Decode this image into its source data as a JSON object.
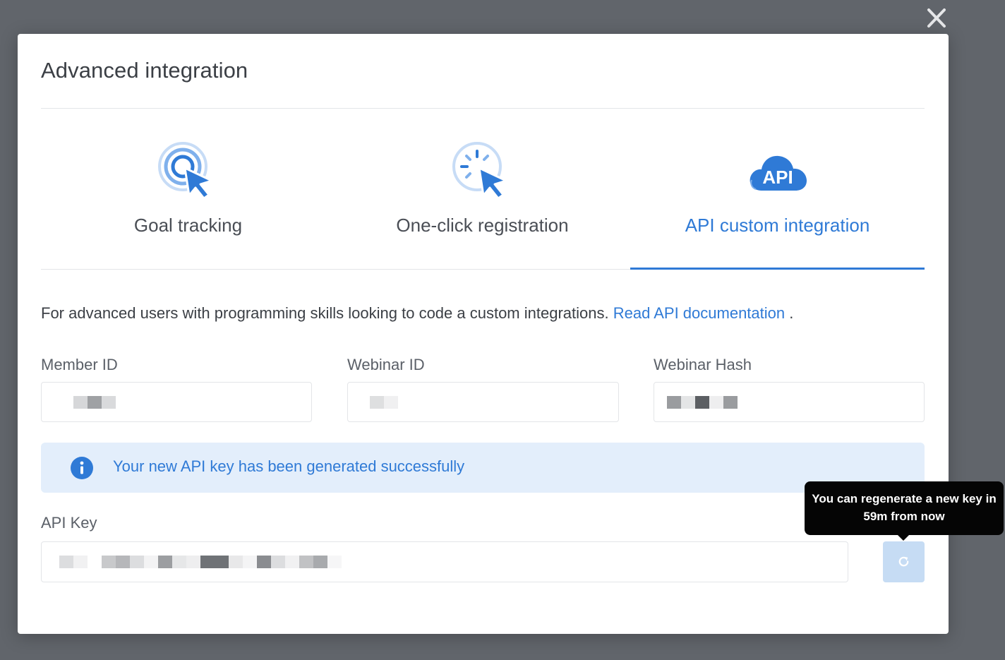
{
  "modal": {
    "title": "Advanced integration"
  },
  "tabs": [
    {
      "label": "Goal tracking",
      "icon": "target-cursor-icon",
      "active": false
    },
    {
      "label": "One-click registration",
      "icon": "click-cursor-icon",
      "active": false
    },
    {
      "label": "API custom integration",
      "icon": "api-cloud-icon",
      "icon_text": "API",
      "active": true
    }
  ],
  "description": {
    "text": "For advanced users with programming skills looking to code a custom integrations.",
    "link_label": "Read API documentation",
    "suffix": "."
  },
  "fields": {
    "member_id": {
      "label": "Member ID"
    },
    "webinar_id": {
      "label": "Webinar ID"
    },
    "webinar_hash": {
      "label": "Webinar Hash"
    },
    "api_key": {
      "label": "API Key"
    }
  },
  "alert": {
    "text": "Your new API key has been generated successfully",
    "icon": "info-icon"
  },
  "regenerate": {
    "icon": "refresh-icon",
    "tooltip_line1": "You can regenerate a new key in",
    "tooltip_line2": "59m from now"
  },
  "colors": {
    "accent": "#2f7ad6",
    "alert_bg": "#e3eefb",
    "overlay": "#61656b",
    "tooltip_bg": "#050505"
  }
}
